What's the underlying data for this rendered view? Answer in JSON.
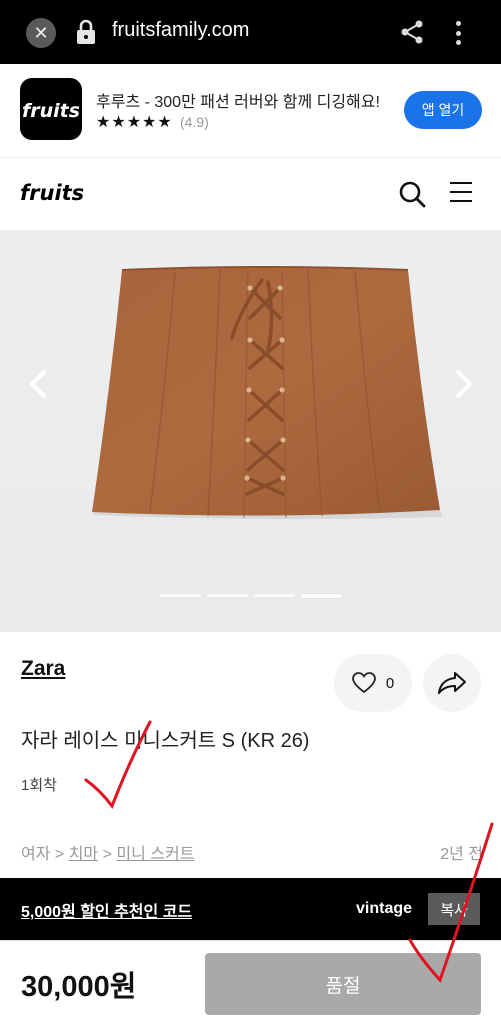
{
  "browser": {
    "url": "fruitsfamily.com"
  },
  "app_banner": {
    "logo_text": "fruits",
    "title": "후루츠 - 300만 패션 러버와 함께 디깅해요!",
    "stars": "★★★★★",
    "rating": "(4.9)",
    "open_button": "앱 열기"
  },
  "header": {
    "logo_text": "fruits"
  },
  "gallery": {
    "image_count": 4,
    "active_index": 3
  },
  "product": {
    "brand": "Zara",
    "like_count": "0",
    "name": "자라 레이스 미니스커트 S (KR 26)",
    "condition": "1회착",
    "breadcrumb": {
      "level1": "여자",
      "sep1": " > ",
      "level2": "치마",
      "sep2": " > ",
      "level3": "미니 스커트"
    },
    "posted": "2년 전"
  },
  "referral": {
    "text": "5,000원 할인 추천인 코드",
    "code": "vintage",
    "copy_button": "복사"
  },
  "bottom_bar": {
    "price": "30,000원",
    "status_button": "품절"
  },
  "colors": {
    "accent": "#1a73e8",
    "skirt": "#a9643a",
    "annotation": "#e0141e"
  }
}
